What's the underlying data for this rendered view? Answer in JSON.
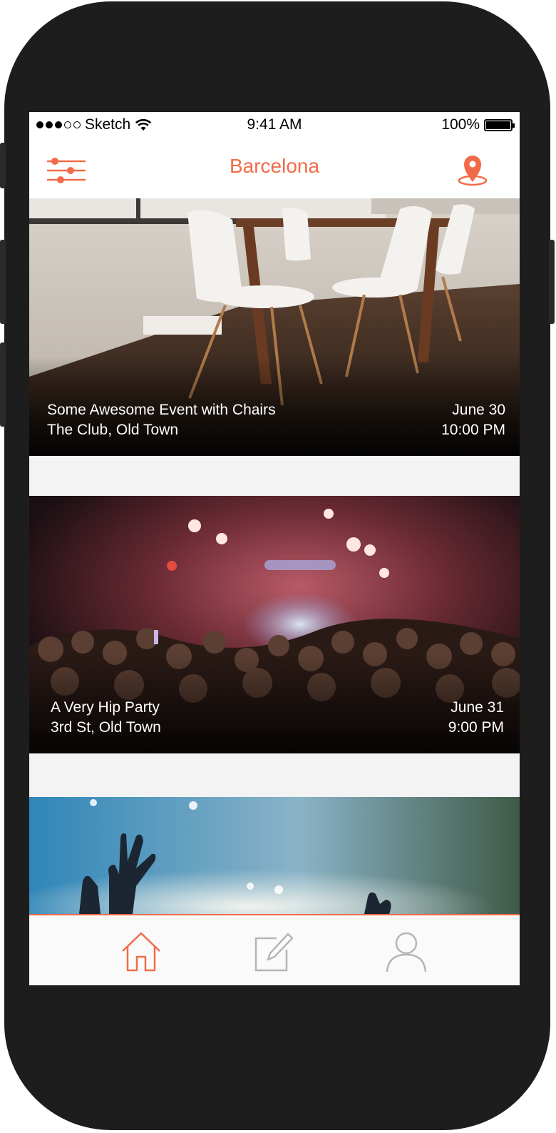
{
  "status_bar": {
    "carrier": "Sketch",
    "time": "9:41 AM",
    "battery": "100%"
  },
  "nav": {
    "title": "Barcelona",
    "left_icon": "filter-sliders-icon",
    "right_icon": "location-pin-icon"
  },
  "events": [
    {
      "title": "Some Awesome Event with Chairs",
      "venue": "The Club, Old Town",
      "date": "June 30",
      "time": "10:00 PM"
    },
    {
      "title": "A Very Hip Party",
      "venue": "3rd St, Old Town",
      "date": "June 31",
      "time": "9:00 PM"
    }
  ],
  "tabbar": {
    "tabs": [
      {
        "icon": "home-icon",
        "active": true
      },
      {
        "icon": "compose-icon",
        "active": false
      },
      {
        "icon": "profile-icon",
        "active": false
      }
    ]
  },
  "colors": {
    "accent": "#f26b48",
    "inactive": "#b5b5b5",
    "separator": "#f3f3f3"
  }
}
